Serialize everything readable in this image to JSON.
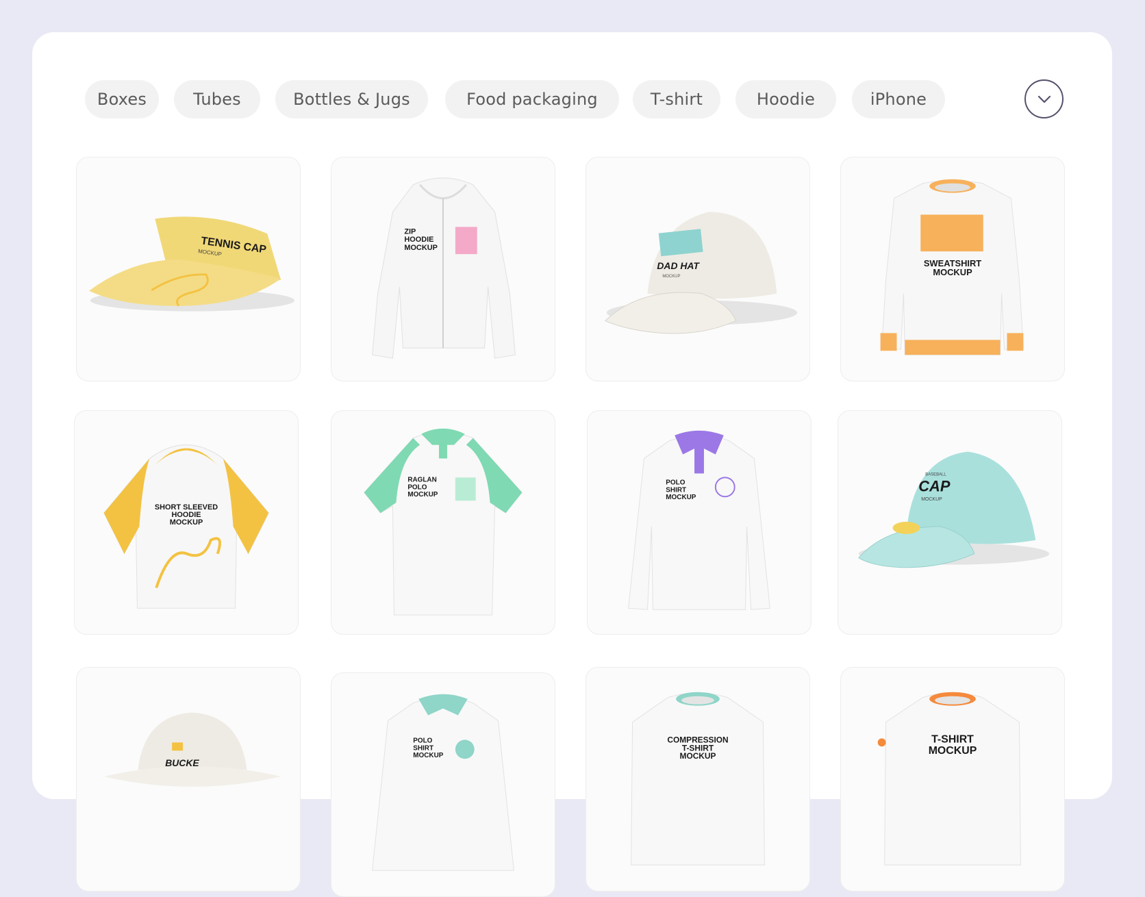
{
  "categories": [
    {
      "label": "Boxes"
    },
    {
      "label": "Tubes"
    },
    {
      "label": "Bottles & Jugs"
    },
    {
      "label": "Food packaging"
    },
    {
      "label": "T-shirt"
    },
    {
      "label": "Hoodie"
    },
    {
      "label": "iPhone"
    }
  ],
  "expand_icon": "chevron-down-icon",
  "mockups": [
    {
      "title_line1": "TENNIS CAP",
      "title_line2": "MOCKUP",
      "accent": "#f4dc86"
    },
    {
      "title_line1": "ZIP",
      "title_line2": "HOODIE",
      "title_line3": "MOCKUP",
      "accent": "#f4a9c8"
    },
    {
      "title_line1": "DAD HAT",
      "title_line2": "MOCKUP",
      "accent": "#8ed3cf"
    },
    {
      "title_line1": "SWEATSHIRT",
      "title_line2": "MOCKUP",
      "accent": "#f7b15b"
    },
    {
      "title_line1": "SHORT SLEEVED",
      "title_line2": "HOODIE",
      "title_line3": "MOCKUP",
      "accent": "#f3c242"
    },
    {
      "title_line1": "RAGLAN",
      "title_line2": "POLO",
      "title_line3": "MOCKUP",
      "accent": "#7fd9b2"
    },
    {
      "title_line1": "POLO",
      "title_line2": "SHIRT",
      "title_line3": "MOCKUP",
      "accent": "#9b78e6"
    },
    {
      "title_line1": "BASEBALL",
      "title_line2": "CAP",
      "title_line3": "MOCKUP",
      "accent": "#a9e0dc"
    },
    {
      "title_line1": "BUCKE",
      "accent": "#f3c242"
    },
    {
      "title_line1": "POLO",
      "title_line2": "SHIRT",
      "title_line3": "MOCKUP",
      "accent": "#8fd5c8"
    },
    {
      "title_line1": "COMPRESSION",
      "title_line2": "T-SHIRT",
      "title_line3": "MOCKUP",
      "accent": "#8fd5c8"
    },
    {
      "title_line1": "T-SHIRT",
      "title_line2": "MOCKUP",
      "accent": "#f58a3c"
    }
  ]
}
